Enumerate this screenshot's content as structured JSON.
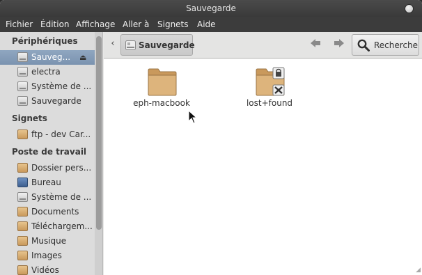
{
  "window": {
    "title": "Sauvegarde"
  },
  "menubar": [
    "Fichier",
    "Édition",
    "Affichage",
    "Aller à",
    "Signets",
    "Aide"
  ],
  "sidebar": {
    "sections": {
      "devices": "Périphériques",
      "bookmarks": "Signets",
      "workspace": "Poste de travail"
    },
    "devices": [
      {
        "label": "Sauveg...",
        "icon": "drive-icon",
        "selected": true,
        "eject": "⏏"
      },
      {
        "label": "electra",
        "icon": "drive-icon"
      },
      {
        "label": "Système de ...",
        "icon": "drive-icon"
      },
      {
        "label": "Sauvegarde",
        "icon": "drive-icon"
      }
    ],
    "bookmarks": [
      {
        "label": "ftp - dev Car...",
        "icon": "network-folder-icon"
      }
    ],
    "workspace": [
      {
        "label": "Dossier pers...",
        "icon": "home-folder-icon"
      },
      {
        "label": "Bureau",
        "icon": "desktop-icon"
      },
      {
        "label": "Système de ...",
        "icon": "drive-icon"
      },
      {
        "label": "Documents",
        "icon": "documents-folder-icon"
      },
      {
        "label": "Téléchargem...",
        "icon": "downloads-folder-icon"
      },
      {
        "label": "Musique",
        "icon": "music-folder-icon"
      },
      {
        "label": "Images",
        "icon": "pictures-folder-icon"
      },
      {
        "label": "Vidéos",
        "icon": "videos-folder-icon"
      }
    ]
  },
  "toolbar": {
    "back": "‹",
    "path": "Sauvegarde",
    "nav_back": "🡐",
    "nav_forward": "🡒",
    "search": "Recherche"
  },
  "files": [
    {
      "label": "eph-macbook",
      "icon": "folder-icon"
    },
    {
      "label": "lost+found",
      "icon": "locked-folder-icon"
    }
  ],
  "colors": {
    "selection": "#7b93b0",
    "folder": "#d2a468",
    "titlebar": "#3a3a3a"
  }
}
